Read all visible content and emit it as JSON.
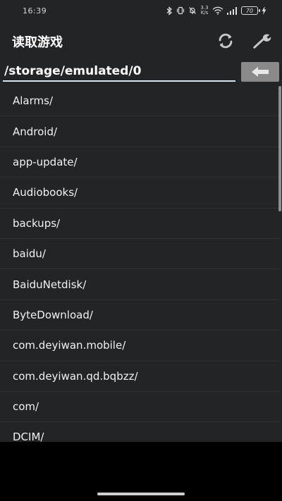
{
  "status_bar": {
    "time": "16:39",
    "net_speed_top": "3.3",
    "net_speed_bottom": "K/s",
    "battery": "70"
  },
  "app_bar": {
    "title": "读取游戏",
    "refresh_icon": "refresh-icon",
    "settings_icon": "wrench-icon"
  },
  "path_bar": {
    "value": "/storage/emulated/0",
    "back_icon": "arrow-left-icon"
  },
  "files": [
    {
      "name": "Alarms/"
    },
    {
      "name": "Android/"
    },
    {
      "name": "app-update/"
    },
    {
      "name": "Audiobooks/"
    },
    {
      "name": "backups/"
    },
    {
      "name": "baidu/"
    },
    {
      "name": "BaiduNetdisk/"
    },
    {
      "name": "ByteDownload/"
    },
    {
      "name": "com.deyiwan.mobile/"
    },
    {
      "name": "com.deyiwan.qd.bqbzz/"
    },
    {
      "name": "com/"
    },
    {
      "name": "DCIM/"
    }
  ],
  "colors": {
    "background": "#222426",
    "accent_underline": "#d7e4ee",
    "back_button": "#8a8a8a"
  }
}
